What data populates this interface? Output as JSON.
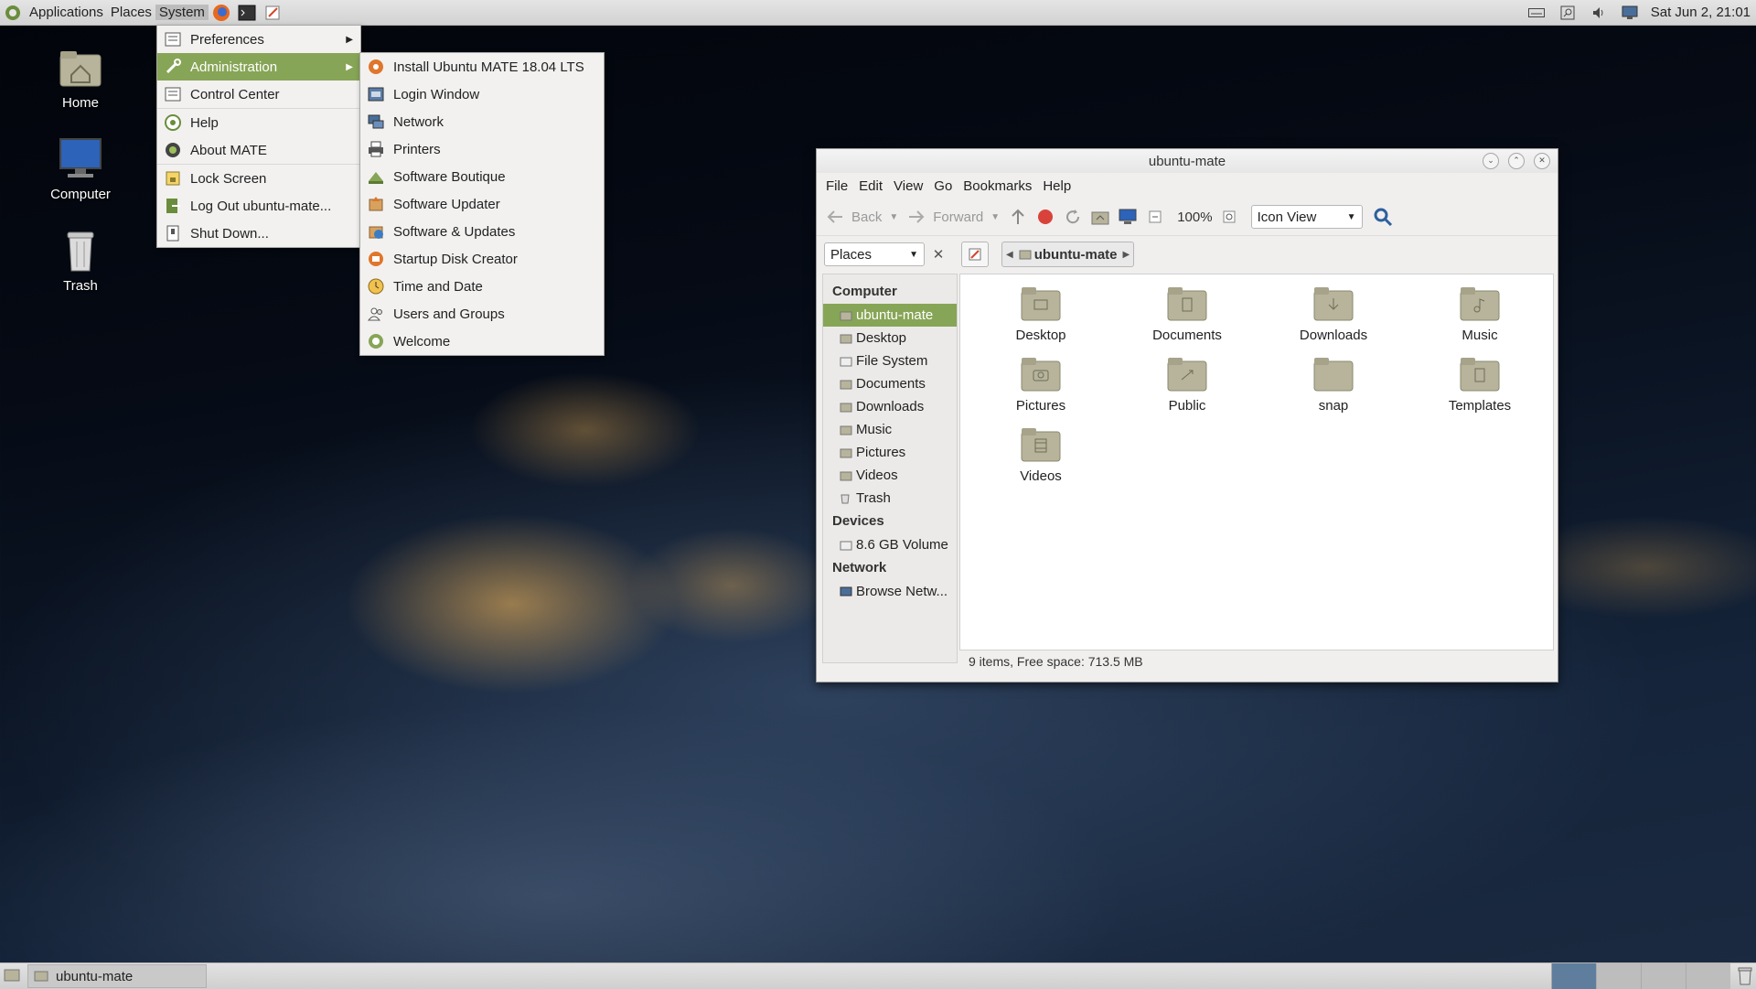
{
  "top_panel": {
    "menus": [
      "Applications",
      "Places",
      "System"
    ],
    "launchers": [
      "firefox-icon",
      "terminal-icon",
      "text-editor-icon"
    ],
    "clock": "Sat Jun 2, 21:01"
  },
  "desktop": {
    "icons": [
      {
        "label": "Home",
        "icon": "home-folder-icon"
      },
      {
        "label": "Computer",
        "icon": "computer-icon"
      },
      {
        "label": "Trash",
        "icon": "trash-icon"
      }
    ]
  },
  "system_menu": {
    "items": [
      {
        "label": "Preferences",
        "submenu": true
      },
      {
        "label": "Administration",
        "submenu": true,
        "selected": true
      },
      {
        "label": "Control Center"
      },
      {
        "label": "Help"
      },
      {
        "label": "About MATE"
      },
      {
        "label": "Lock Screen"
      },
      {
        "label": "Log Out ubuntu-mate..."
      },
      {
        "label": "Shut Down..."
      }
    ]
  },
  "admin_submenu": {
    "items": [
      "Install Ubuntu MATE 18.04 LTS",
      "Login Window",
      "Network",
      "Printers",
      "Software Boutique",
      "Software Updater",
      "Software & Updates",
      "Startup Disk Creator",
      "Time and Date",
      "Users and Groups",
      "Welcome"
    ]
  },
  "file_manager": {
    "title": "ubuntu-mate",
    "menubar": [
      "File",
      "Edit",
      "View",
      "Go",
      "Bookmarks",
      "Help"
    ],
    "toolbar": {
      "back": "Back",
      "forward": "Forward",
      "zoom": "100%",
      "view_mode": "Icon View"
    },
    "location": {
      "places_label": "Places",
      "crumb": "ubuntu-mate"
    },
    "sidebar": {
      "computer_heading": "Computer",
      "computer_items": [
        "ubuntu-mate",
        "Desktop",
        "File System",
        "Documents",
        "Downloads",
        "Music",
        "Pictures",
        "Videos",
        "Trash"
      ],
      "devices_heading": "Devices",
      "devices_items": [
        "8.6 GB Volume"
      ],
      "network_heading": "Network",
      "network_items": [
        "Browse Netw..."
      ]
    },
    "files": [
      "Desktop",
      "Documents",
      "Downloads",
      "Music",
      "Pictures",
      "Public",
      "snap",
      "Templates",
      "Videos"
    ],
    "status": "9 items, Free space: 713.5 MB"
  },
  "bottom_panel": {
    "task": "ubuntu-mate"
  },
  "colors": {
    "selection": "#87a556",
    "panel": "#d8d8d8"
  }
}
